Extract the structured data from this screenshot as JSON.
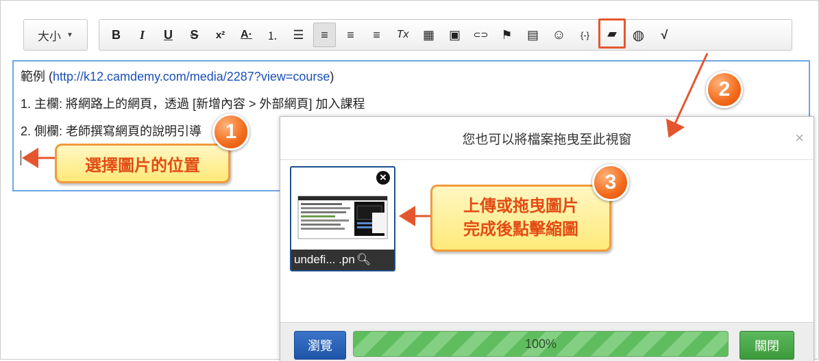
{
  "toolbar": {
    "size_label": "大小",
    "buttons": [
      {
        "name": "bold-button",
        "glyph": "B"
      },
      {
        "name": "italic-button",
        "glyph": "I"
      },
      {
        "name": "underline-button",
        "glyph": "U"
      },
      {
        "name": "strikethrough-button",
        "glyph": "S"
      },
      {
        "name": "superscript-button",
        "glyph": "x²"
      },
      {
        "name": "font-color-button",
        "glyph": "A·"
      },
      {
        "name": "ordered-list-button",
        "glyph": "⒈"
      },
      {
        "name": "unordered-list-button",
        "glyph": "☰"
      },
      {
        "name": "align-left-button",
        "glyph": "≡"
      },
      {
        "name": "align-center-button",
        "glyph": "≡"
      },
      {
        "name": "align-right-button",
        "glyph": "≡"
      },
      {
        "name": "clear-format-button",
        "glyph": "Tx"
      },
      {
        "name": "table-button",
        "glyph": "▦"
      },
      {
        "name": "image-button",
        "glyph": "▣"
      },
      {
        "name": "link-button",
        "glyph": "⊂⊃"
      },
      {
        "name": "anchor-flag-button",
        "glyph": "⚑"
      },
      {
        "name": "template-button",
        "glyph": "▤"
      },
      {
        "name": "emoticon-button",
        "glyph": "☺"
      },
      {
        "name": "code-button",
        "glyph": "{-}"
      },
      {
        "name": "file-browser-button",
        "glyph": "▰"
      },
      {
        "name": "web-link-button",
        "glyph": "◍"
      },
      {
        "name": "formula-button",
        "glyph": "√"
      }
    ]
  },
  "editor": {
    "line1_prefix": "範例 (",
    "line1_link": "http://k12.camdemy.com/media/2287?view=course",
    "line1_suffix": ")",
    "line2": "1. 主欄: 將網路上的網頁，透過 [新增內容 > 外部網頁] 加入課程",
    "line3": "2. 側欄: 老師撰寫網頁的說明引導"
  },
  "dialog": {
    "title": "您也可以將檔案拖曳至此視窗",
    "close_glyph": "×",
    "thumbnail_caption": "undefi... .pn",
    "progress_text": "100%",
    "progress_value": 1.0,
    "browse_label": "瀏覽",
    "close_label": "關閉"
  },
  "annotations": {
    "step1_number": "1",
    "step1_text": "選擇圖片的位置",
    "step2_number": "2",
    "step3_number": "3",
    "step3_line1": "上傳或拖曳圖片",
    "step3_line2": "完成後點擊縮圖"
  },
  "colors": {
    "accent_orange": "#e4572e",
    "editor_border": "#6aa6e6",
    "browse_blue": "#2a64b8",
    "close_green": "#4cae4c",
    "progress_green": "#5fbd5f"
  }
}
